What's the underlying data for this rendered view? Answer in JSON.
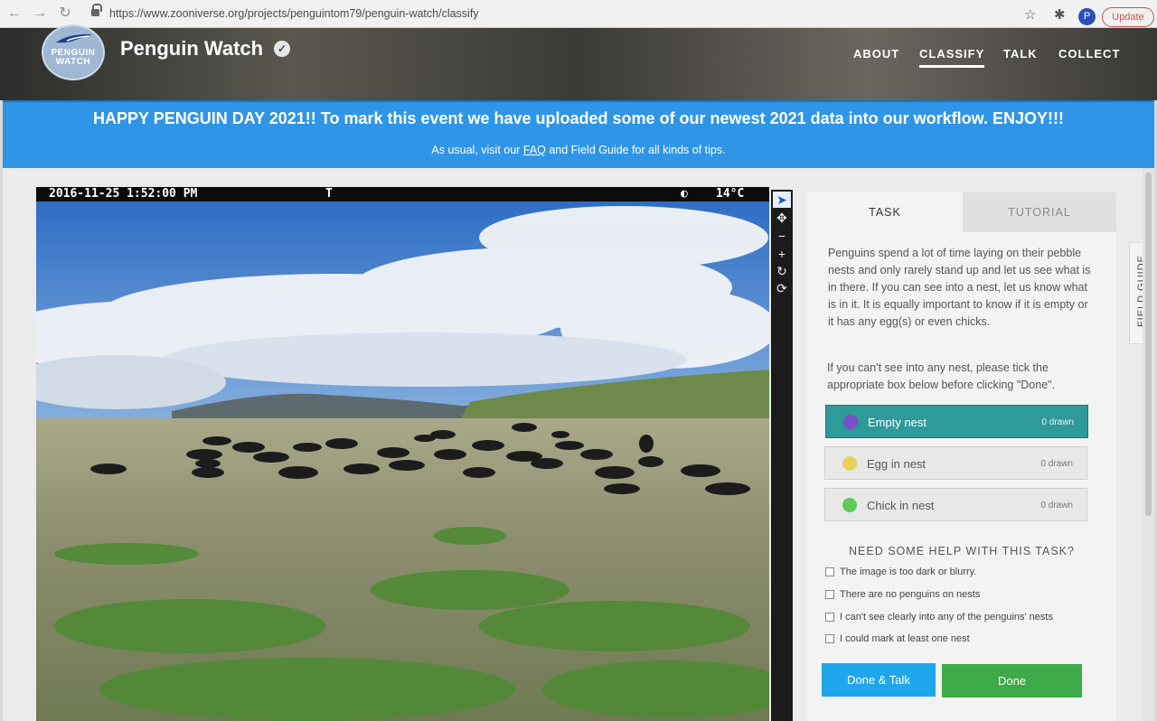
{
  "browser": {
    "url": "https://www.zooniverse.org/projects/penguintom79/penguin-watch/classify",
    "update_label": "Update",
    "profile_initial": "P"
  },
  "header": {
    "logo_text": "PENGUIN WATCH",
    "title": "Penguin Watch",
    "nav": [
      "ABOUT",
      "CLASSIFY",
      "TALK",
      "COLLECT"
    ],
    "active_nav": "CLASSIFY"
  },
  "banner": {
    "main": "HAPPY PENGUIN DAY 2021!! To mark this event we have uploaded some of our newest 2021 data into our workflow. ENJOY!!!",
    "sub_before": "As usual, visit our",
    "sub_link": "FAQ",
    "sub_after": "and Field Guide for all kinds of tips."
  },
  "camera": {
    "timestamp": "2016-11-25  1:52:00 PM",
    "flag": "T",
    "temperature": "14°C"
  },
  "task_panel": {
    "tabs": [
      "TASK",
      "TUTORIAL"
    ],
    "instructions": "Penguins spend a lot of time laying on their pebble nests and only rarely stand up and let us see what is in there. If you can see into a nest, let us know what is in it. It is equally important to know if it is empty or it has any egg(s) or even chicks.",
    "instructions2": "If you can't see into any nest, please tick the appropriate box below before clicking \"Done\".",
    "tools": [
      {
        "label": "Empty nest",
        "count": "0 drawn",
        "color": "#7b4fc8"
      },
      {
        "label": "Egg in nest",
        "count": "0 drawn",
        "color": "#e3d35a"
      },
      {
        "label": "Chick in nest",
        "count": "0 drawn",
        "color": "#5fc95a"
      }
    ],
    "help_title": "NEED SOME HELP WITH THIS TASK?",
    "checkboxes": [
      "The image is too dark or blurry.",
      "There are no penguins on nests",
      "I can't see clearly into any of the penguins' nests",
      "I could mark at least one nest"
    ],
    "done_talk_label": "Done & Talk",
    "done_label": "Done"
  },
  "field_guide_label": "FIELD GUIDE",
  "colors": {
    "banner": "#2f95e6",
    "selected_tool": "#2e9a99",
    "done_talk": "#1fa7ec",
    "done": "#3faa48"
  }
}
